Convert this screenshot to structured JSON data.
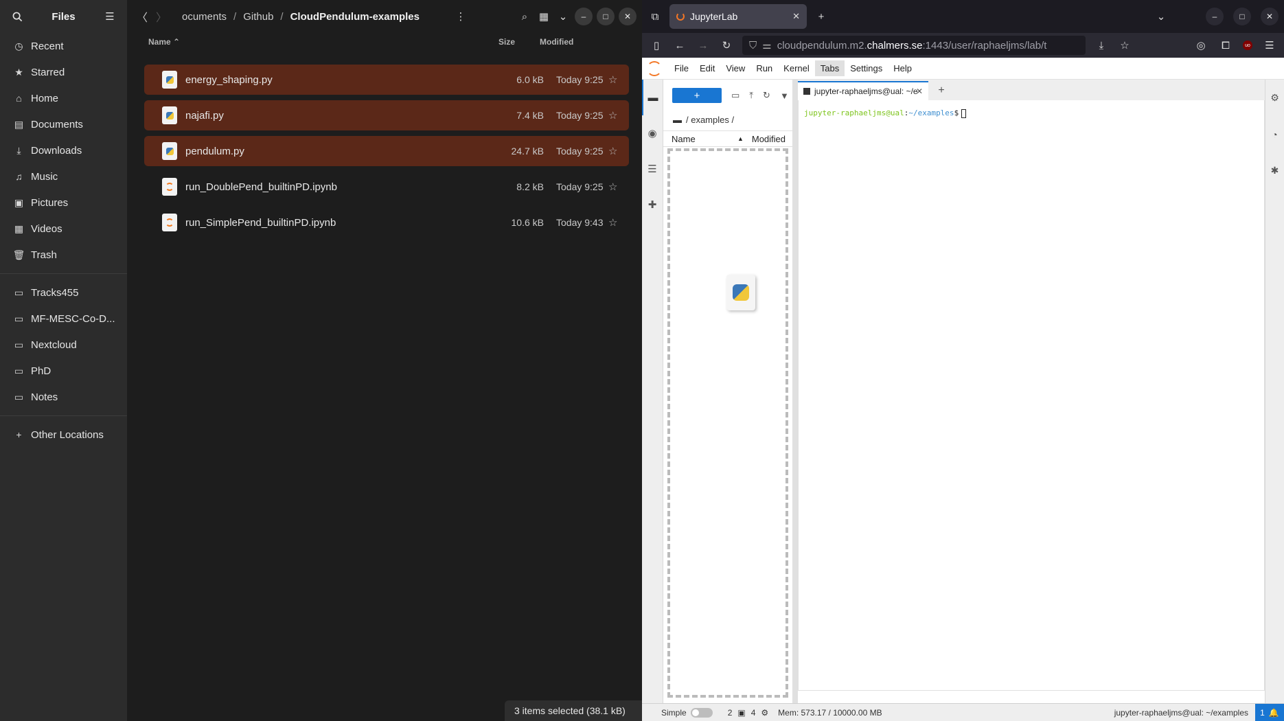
{
  "files_app": {
    "title": "Files",
    "sidebar": {
      "places": [
        {
          "label": "Recent",
          "icon": "clock-icon"
        },
        {
          "label": "Starred",
          "icon": "star-icon"
        },
        {
          "label": "Home",
          "icon": "home-icon"
        },
        {
          "label": "Documents",
          "icon": "document-icon"
        },
        {
          "label": "Downloads",
          "icon": "download-icon"
        },
        {
          "label": "Music",
          "icon": "music-icon"
        },
        {
          "label": "Pictures",
          "icon": "picture-icon"
        },
        {
          "label": "Videos",
          "icon": "video-icon"
        },
        {
          "label": "Trash",
          "icon": "trash-icon"
        }
      ],
      "bookmarks": [
        {
          "label": "Tracks455"
        },
        {
          "label": "MF-MESC-Co-D..."
        },
        {
          "label": "Nextcloud"
        },
        {
          "label": "PhD"
        },
        {
          "label": "Notes"
        }
      ],
      "other_locations": "Other Locations"
    },
    "breadcrumb": [
      "ocuments",
      "Github",
      "CloudPendulum-examples"
    ],
    "columns": {
      "name": "Name",
      "size": "Size",
      "modified": "Modified"
    },
    "files": [
      {
        "name": "energy_shaping.py",
        "size": "6.0 kB",
        "modified": "Today 9:25",
        "type": "py",
        "selected": true
      },
      {
        "name": "najafi.py",
        "size": "7.4 kB",
        "modified": "Today 9:25",
        "type": "py",
        "selected": true
      },
      {
        "name": "pendulum.py",
        "size": "24.7 kB",
        "modified": "Today 9:25",
        "type": "py",
        "selected": true
      },
      {
        "name": "run_DoublePend_builtinPD.ipynb",
        "size": "8.2 kB",
        "modified": "Today 9:25",
        "type": "ipynb",
        "selected": false
      },
      {
        "name": "run_SimplePend_builtinPD.ipynb",
        "size": "10.6 kB",
        "modified": "Today 9:43",
        "type": "ipynb",
        "selected": false
      }
    ],
    "status": "3 items selected (38.1 kB)",
    "accent_selected": "#5b2818"
  },
  "browser": {
    "tab_title": "JupyterLab",
    "url_prefix": "cloudpendulum.m2.",
    "url_host": "chalmers.se",
    "url_path": ":1443/user/raphaeljms/lab/t",
    "ublock_badge": "uo"
  },
  "jupyter": {
    "menu": [
      "File",
      "Edit",
      "View",
      "Run",
      "Kernel",
      "Tabs",
      "Settings",
      "Help"
    ],
    "active_menu": "Tabs",
    "new_button": "+",
    "path": "/ examples /",
    "columns": {
      "name": "Name",
      "modified": "Modified"
    },
    "terminal_tab": "jupyter-raphaeljms@ual: ~/e",
    "prompt_user": "jupyter-raphaeljms@ual",
    "prompt_sep": ":",
    "prompt_path": "~/examples",
    "prompt_end": "$",
    "status": {
      "mode": "Simple",
      "terminals": "2",
      "kernels": "4",
      "memory": "Mem: 573.17 / 10000.00 MB",
      "location": "jupyter-raphaeljms@ual: ~/examples",
      "notifications": "1"
    },
    "accent": "#1976d2"
  }
}
